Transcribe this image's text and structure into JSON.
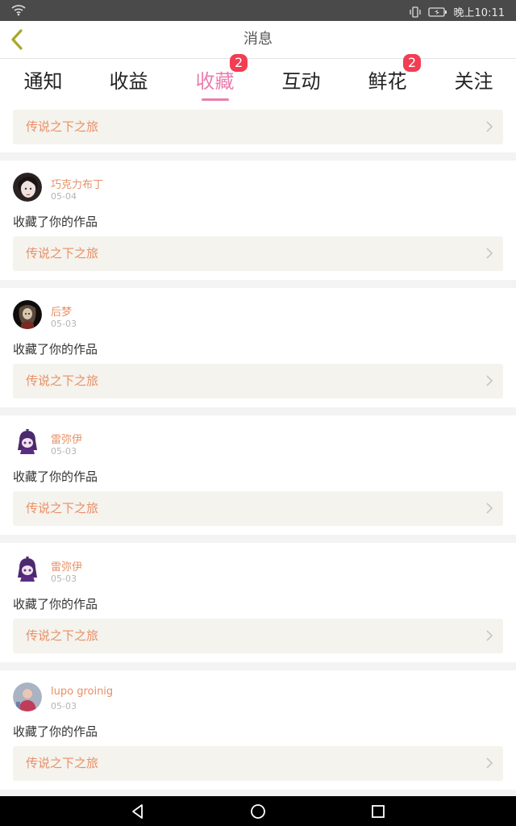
{
  "status_bar": {
    "time": "晚上10:11"
  },
  "header": {
    "title": "消息"
  },
  "tabs": [
    {
      "label": "通知",
      "badge": ""
    },
    {
      "label": "收益",
      "badge": ""
    },
    {
      "label": "收藏",
      "badge": "2",
      "active": true
    },
    {
      "label": "互动",
      "badge": ""
    },
    {
      "label": "鲜花",
      "badge": "2"
    },
    {
      "label": "关注",
      "badge": ""
    }
  ],
  "first_item": {
    "work_title": "传说之下之旅"
  },
  "items": [
    {
      "user": "巧克力布丁",
      "date": "05-04",
      "action": "收藏了你的作品",
      "work_title": "传说之下之旅"
    },
    {
      "user": "后梦",
      "date": "05-03",
      "action": "收藏了你的作品",
      "work_title": "传说之下之旅"
    },
    {
      "user": "雷弥伊",
      "date": "05-03",
      "action": "收藏了你的作品",
      "work_title": "传说之下之旅"
    },
    {
      "user": "雷弥伊",
      "date": "05-03",
      "action": "收藏了你的作品",
      "work_title": "传说之下之旅"
    },
    {
      "user": "lupo groinig",
      "date": "05-03",
      "action": "收藏了你的作品",
      "work_title": "传说之下之旅"
    }
  ],
  "colors": {
    "accent": "#e97fae",
    "badge": "#f23d53",
    "username": "#e88f65",
    "work_box_bg": "#f5f3ee"
  }
}
